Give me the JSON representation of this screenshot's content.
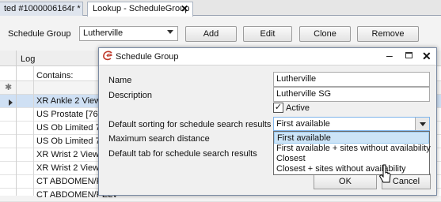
{
  "tabs": [
    {
      "label": "ted #1000006164r *"
    },
    {
      "label": "Lookup - ScheduleGroup",
      "close": "✕"
    }
  ],
  "toolbar": {
    "schedule_group_label": "Schedule Group",
    "schedule_group_value": "Lutherville",
    "add": "Add",
    "edit": "Edit",
    "clone": "Clone",
    "remove": "Remove"
  },
  "grid": {
    "col_log": "Log",
    "filter_label": "Contains:",
    "new_row_marker": "✱",
    "rows": [
      "XR Ankle 2 Views, E",
      "US Prostate [76872]",
      "US Ob Limited 7681",
      "US Ob Limited 7681",
      "XR Wrist 2 Views, E",
      "XR Wrist 2 Views, E",
      "CT ABDOMEN/PELV",
      "CT ABDOMEN/PELV"
    ]
  },
  "dialog": {
    "title": "Schedule Group",
    "fields": {
      "name_label": "Name",
      "name_value": "Lutherville",
      "description_label": "Description",
      "description_value": "Lutherville SG",
      "active_label": "Active",
      "active_checked": "✓",
      "default_sorting_label": "Default sorting for schedule search results",
      "default_sorting_value": "First available",
      "max_distance_label": "Maximum search distance",
      "default_tab_label": "Default tab for schedule search results"
    },
    "dropdown_options": [
      "First available",
      "First available + sites without availability",
      "Closest",
      "Closest + sites without availability"
    ],
    "ok": "OK",
    "cancel": "Cancel"
  }
}
